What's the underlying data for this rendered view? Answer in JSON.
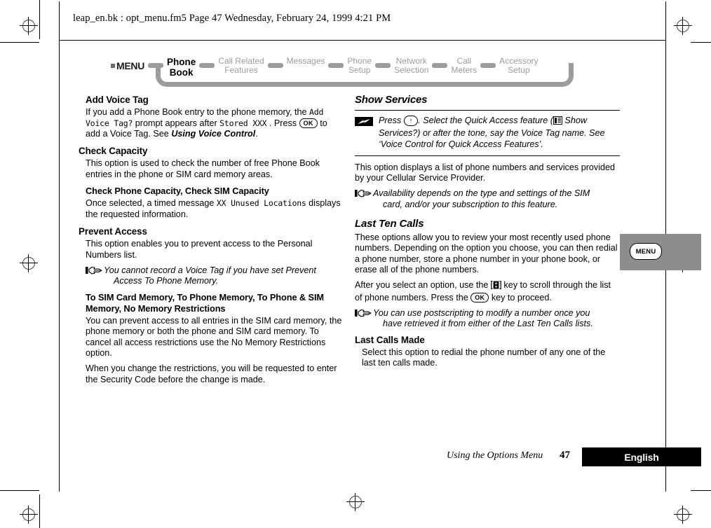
{
  "header": {
    "running_head": "leap_en.bk : opt_menu.fm5  Page 47  Wednesday, February 24, 1999  4:21 PM"
  },
  "nav": {
    "menu_label": "MENU",
    "items": [
      {
        "label": "Phone\nBook",
        "current": true
      },
      {
        "label": "Call Related\nFeatures",
        "current": false
      },
      {
        "label": "Messages",
        "current": false
      },
      {
        "label": "Phone\nSetup",
        "current": false
      },
      {
        "label": "Network\nSelection",
        "current": false
      },
      {
        "label": "Call\nMeters",
        "current": false
      },
      {
        "label": "Accessory\nSetup",
        "current": false
      }
    ]
  },
  "left_column": {
    "add_voice_tag": {
      "heading": "Add Voice Tag",
      "text_1": "If you add a Phone Book entry to the phone memory, the ",
      "lcd_1": "Add Voice Tag?",
      "text_2": " prompt appears after ",
      "lcd_2": "Stored XXX",
      "text_3": " . Press ",
      "key_ok": "OK",
      "text_4": " to add a Voice Tag. See ",
      "ref": "Using Voice Control",
      "text_5": "."
    },
    "check_capacity": {
      "heading": "Check Capacity",
      "body": "This option is used to check the number of free Phone Book entries in the phone or SIM card memory areas.",
      "sub_heading": "Check Phone Capacity, Check SIM Capacity",
      "sub_text_1": "Once selected, a timed message ",
      "sub_lcd": "XX Unused Locations",
      "sub_text_2": " displays the requested information."
    },
    "prevent_access": {
      "heading": "Prevent Access",
      "body": "This option enables you to prevent access to the Personal Numbers list.",
      "note_line_1": "You cannot record a Voice Tag if you have set Prevent",
      "note_line_2": "Access To Phone Memory.",
      "sub_heading": "To SIM Card Memory, To Phone Memory, To Phone & SIM Memory, No Memory Restrictions",
      "para_1": "You can prevent access to all entries in the SIM card memory, the phone memory or both the phone and SIM card memory. To cancel all access restrictions use the No Memory Restrictions option.",
      "para_2": "When you change the restrictions, you will be requested to enter the Security Code before the change is made."
    }
  },
  "right_column": {
    "show_services": {
      "heading": "Show Services",
      "tip_text_1": "Press ",
      "tip_key_arrow": "↑",
      "tip_text_2": ". Select the Quick Access feature (",
      "tip_text_3": " Show Services?) or after the tone, say the Voice Tag name. See ‘Voice Control for Quick Access Features’.",
      "body": "This option displays a list of phone numbers and services provided by your Cellular Service Provider.",
      "note_line_1": "Availability depends on the type and settings of the SIM",
      "note_line_2": "card, and/or your subscription to this feature."
    },
    "last_ten_calls": {
      "heading": "Last Ten Calls",
      "para_1": "These options allow you to review your most recently used phone numbers. Depending on the option you choose, you can then redial a phone number, store a phone number in your phone book, or erase all of the phone numbers.",
      "para_2_text_1": "After you select an option, use the ",
      "para_2_text_2": " key to scroll through the list of phone numbers. Press the ",
      "para_2_key_ok": "OK",
      "para_2_text_3": " key to proceed.",
      "note_line_1": "You can use postscripting to modify a number once you",
      "note_line_2": "have retrieved it from either of the Last Ten Calls lists.",
      "sub_heading": "Last Calls Made",
      "sub_body": "Select this option to redial the phone number of any one of the last ten calls made."
    }
  },
  "margin_tab": {
    "label": "MENU"
  },
  "footer": {
    "chapter": "Using the Options Menu",
    "page_number": "47",
    "language": "English"
  },
  "colors": {
    "nav_inactive": "#9b9b9b",
    "nav_track": "#9c9c9c",
    "margin_tab_bg": "#8d8d8d",
    "lang_tab_bg": "#000000"
  }
}
